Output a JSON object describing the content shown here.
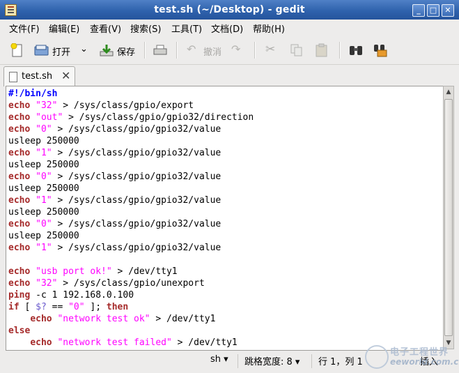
{
  "window": {
    "title": "test.sh (~/Desktop) - gedit"
  },
  "menubar": [
    "文件(F)",
    "编辑(E)",
    "查看(V)",
    "搜索(S)",
    "工具(T)",
    "文档(D)",
    "帮助(H)"
  ],
  "toolbar": {
    "open_label": "打开",
    "save_label": "保存",
    "undo_label": "撤消"
  },
  "tab": {
    "label": "test.sh"
  },
  "code_lines": [
    [
      [
        "sb",
        "#!/bin/sh"
      ]
    ],
    [
      [
        "kw",
        "echo"
      ],
      [
        "",
        " "
      ],
      [
        "str",
        "\"32\""
      ],
      [
        "",
        " > /sys/class/gpio/export"
      ]
    ],
    [
      [
        "kw",
        "echo"
      ],
      [
        "",
        " "
      ],
      [
        "str",
        "\"out\""
      ],
      [
        "",
        " > /sys/class/gpio/gpio32/direction"
      ]
    ],
    [
      [
        "kw",
        "echo"
      ],
      [
        "",
        " "
      ],
      [
        "str",
        "\"0\""
      ],
      [
        "",
        " > /sys/class/gpio/gpio32/value"
      ]
    ],
    [
      [
        "",
        "usleep 250000"
      ]
    ],
    [
      [
        "kw",
        "echo"
      ],
      [
        "",
        " "
      ],
      [
        "str",
        "\"1\""
      ],
      [
        "",
        " > /sys/class/gpio/gpio32/value"
      ]
    ],
    [
      [
        "",
        "usleep 250000"
      ]
    ],
    [
      [
        "kw",
        "echo"
      ],
      [
        "",
        " "
      ],
      [
        "str",
        "\"0\""
      ],
      [
        "",
        " > /sys/class/gpio/gpio32/value"
      ]
    ],
    [
      [
        "",
        "usleep 250000"
      ]
    ],
    [
      [
        "kw",
        "echo"
      ],
      [
        "",
        " "
      ],
      [
        "str",
        "\"1\""
      ],
      [
        "",
        " > /sys/class/gpio/gpio32/value"
      ]
    ],
    [
      [
        "",
        "usleep 250000"
      ]
    ],
    [
      [
        "kw",
        "echo"
      ],
      [
        "",
        " "
      ],
      [
        "str",
        "\"0\""
      ],
      [
        "",
        " > /sys/class/gpio/gpio32/value"
      ]
    ],
    [
      [
        "",
        "usleep 250000"
      ]
    ],
    [
      [
        "kw",
        "echo"
      ],
      [
        "",
        " "
      ],
      [
        "str",
        "\"1\""
      ],
      [
        "",
        " > /sys/class/gpio/gpio32/value"
      ]
    ],
    [
      [
        "",
        ""
      ]
    ],
    [
      [
        "kw",
        "echo"
      ],
      [
        "",
        " "
      ],
      [
        "str",
        "\"usb port ok!\""
      ],
      [
        "",
        " > /dev/tty1"
      ]
    ],
    [
      [
        "kw",
        "echo"
      ],
      [
        "",
        " "
      ],
      [
        "str",
        "\"32\""
      ],
      [
        "",
        " > /sys/class/gpio/unexport"
      ]
    ],
    [
      [
        "kw",
        "ping"
      ],
      [
        "",
        " -c 1 192.168.0.100"
      ]
    ],
    [
      [
        "kw",
        "if"
      ],
      [
        "",
        " [ "
      ],
      [
        "var",
        "$?"
      ],
      [
        "",
        " == "
      ],
      [
        "str",
        "\"0\""
      ],
      [
        "",
        " ]; "
      ],
      [
        "kw",
        "then"
      ]
    ],
    [
      [
        "",
        "    "
      ],
      [
        "kw",
        "echo"
      ],
      [
        "",
        " "
      ],
      [
        "str",
        "\"network test ok\""
      ],
      [
        "",
        " > /dev/tty1"
      ]
    ],
    [
      [
        "kw",
        "else"
      ]
    ],
    [
      [
        "",
        "    "
      ],
      [
        "kw",
        "echo"
      ],
      [
        "",
        " "
      ],
      [
        "str",
        "\"network test failed\""
      ],
      [
        "",
        " > /dev/tty1"
      ]
    ]
  ],
  "statusbar": {
    "language": "sh ▾",
    "tab_width": "跳格宽度: 8 ▾",
    "position": "行 1，列 1",
    "mode": "插入"
  },
  "watermark": {
    "line1": "电子工程世界",
    "line2": "eeworld.com.cn"
  },
  "colors": {
    "titlebar": "#2f62ad",
    "keyword": "#a52a2a",
    "string": "#ff00ff",
    "shebang": "#0000ff"
  }
}
